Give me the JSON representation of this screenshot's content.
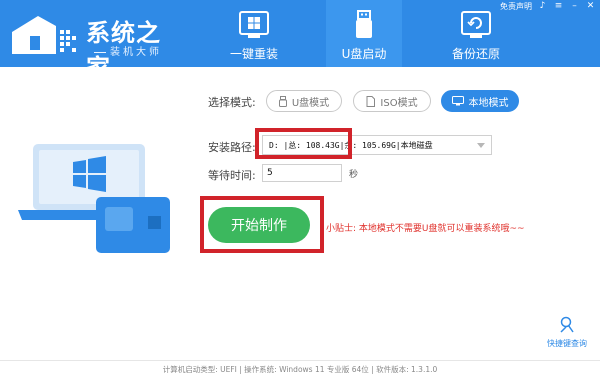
{
  "brand": {
    "title": "系统之家",
    "subtitle": "装机大师"
  },
  "topbar": {
    "free_declare": "免责声明",
    "icons": [
      "bell-icon",
      "menu-icon",
      "minimize-icon",
      "close-icon"
    ]
  },
  "tabs": [
    {
      "label": "一键重装",
      "icon": "windows-screen-icon",
      "active": false
    },
    {
      "label": "U盘启动",
      "icon": "usb-drive-icon",
      "active": true
    },
    {
      "label": "备份还原",
      "icon": "backup-restore-icon",
      "active": false
    }
  ],
  "form": {
    "mode_label": "选择模式:",
    "modes": [
      {
        "label": "U盘模式",
        "icon": "usb-icon",
        "active": false
      },
      {
        "label": "ISO模式",
        "icon": "file-icon",
        "active": false
      },
      {
        "label": "本地模式",
        "icon": "monitor-icon",
        "active": true
      }
    ],
    "path_label": "安装路径:",
    "path_value": "D: |总: 108.43G|余: 105.69G|本地磁盘",
    "wait_label": "等待时间:",
    "wait_value": "5",
    "wait_unit": "秒",
    "start_label": "开始制作",
    "tip": "小贴士: 本地模式不需要U盘就可以重装系统哦~~"
  },
  "hotkey": {
    "label": "快捷键查询",
    "icon": "hotkey-search-icon"
  },
  "footer": {
    "text": "计算机启动类型: UEFI | 操作系统: Windows 11 专业版 64位 | 软件版本: 1.3.1.0"
  },
  "colors": {
    "header": "#2f8ae6",
    "active_tab": "#3c97ee",
    "start_button": "#3cb85e",
    "tip_text": "#e0322d",
    "highlight": "#d1232a"
  }
}
